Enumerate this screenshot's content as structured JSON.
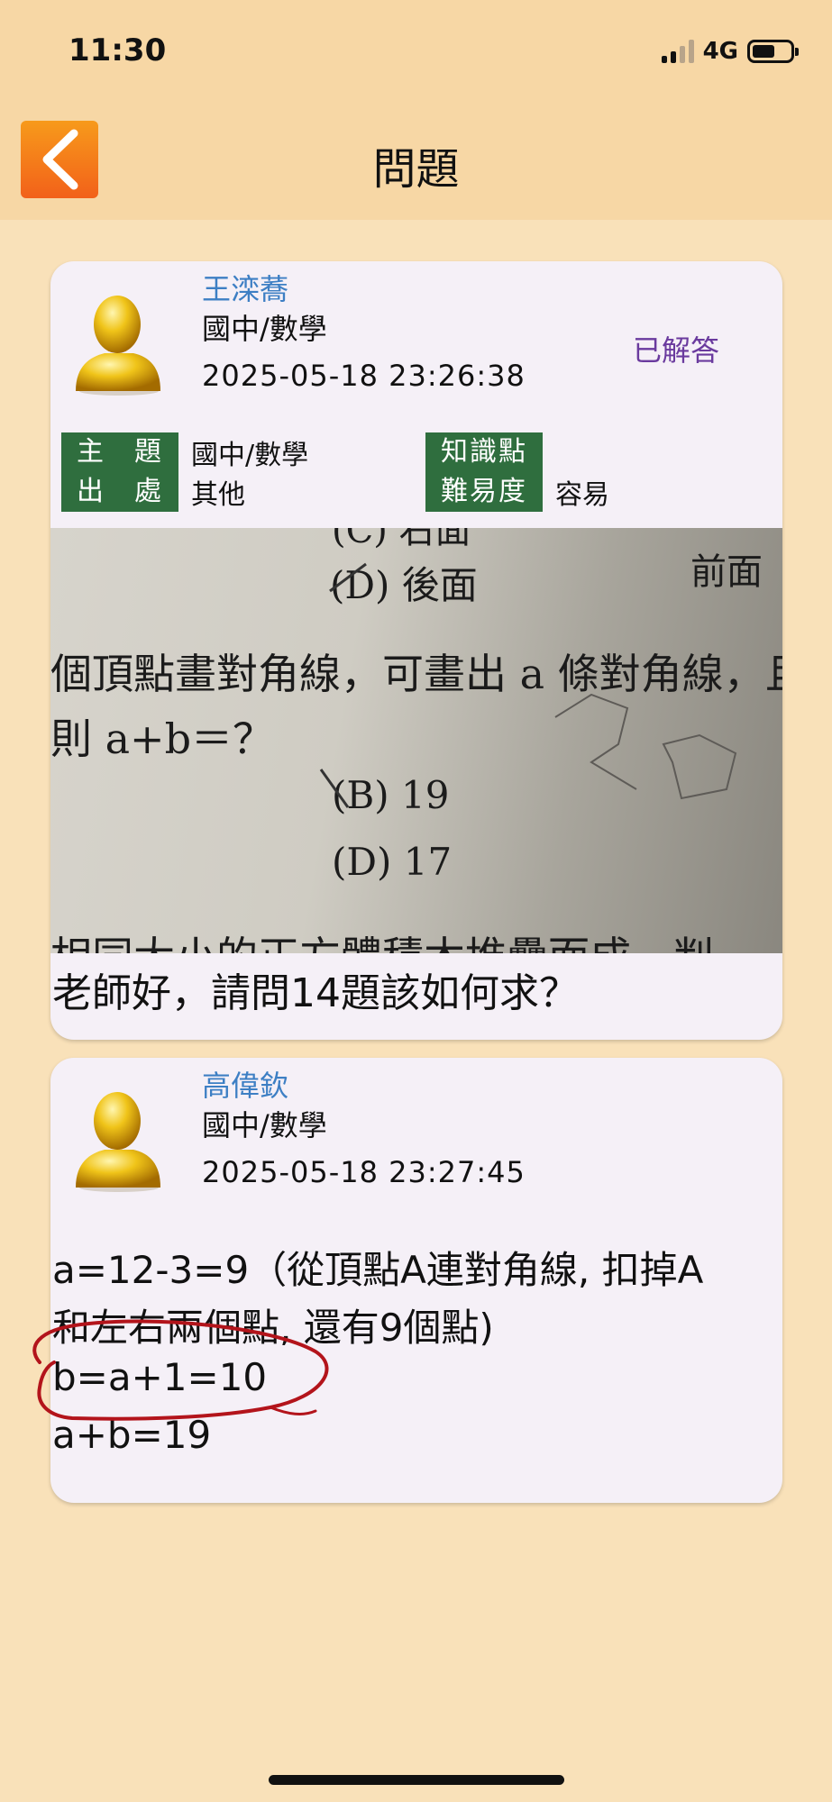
{
  "status_bar": {
    "time": "11:30",
    "network": "4G"
  },
  "header": {
    "title": "問題"
  },
  "question": {
    "author": "王滦蕎",
    "category": "國中/數學",
    "timestamp": "2025-05-18 23:26:38",
    "status": "已解答",
    "fields": {
      "topic_label": "主　題",
      "topic_value": "國中/數學",
      "source_label": "出　處",
      "source_value": "其他",
      "knowledge_label": "知識點",
      "knowledge_value": "",
      "difficulty_label": "難易度",
      "difficulty_value": "容易"
    },
    "photo_text": {
      "top_fragment": "(C) 右面",
      "option_d_top": "(D) 後面",
      "front": "前面",
      "line1": "個頂點畫對角線，可畫出 a 條對角線，且",
      "line2": "則 a+b＝？",
      "option_b": "(B) 19",
      "option_d": "(D) 17",
      "bottom_fragment": "相同大小的正方體積木堆疊而成。判"
    },
    "text": "老師好，請問14題該如何求？"
  },
  "answer": {
    "author": "高偉欽",
    "category": "國中/數學",
    "timestamp": "2025-05-18 23:27:45",
    "lines": [
      "a=12-3=9（從頂點A連對角線, 扣掉A",
      "和左右兩個點, 還有9個點)",
      "b=a+1=10",
      "a+b=19"
    ]
  },
  "colors": {
    "background": "#f9e1b9",
    "header": "#f7d7a5",
    "card": "#f5f0f7",
    "author_name": "#3d7fc4",
    "answered_status": "#6a3a9e",
    "tag_bg": "#2f6e3e",
    "back_button": "#f2611a",
    "annotation_circle": "#b3141b"
  }
}
